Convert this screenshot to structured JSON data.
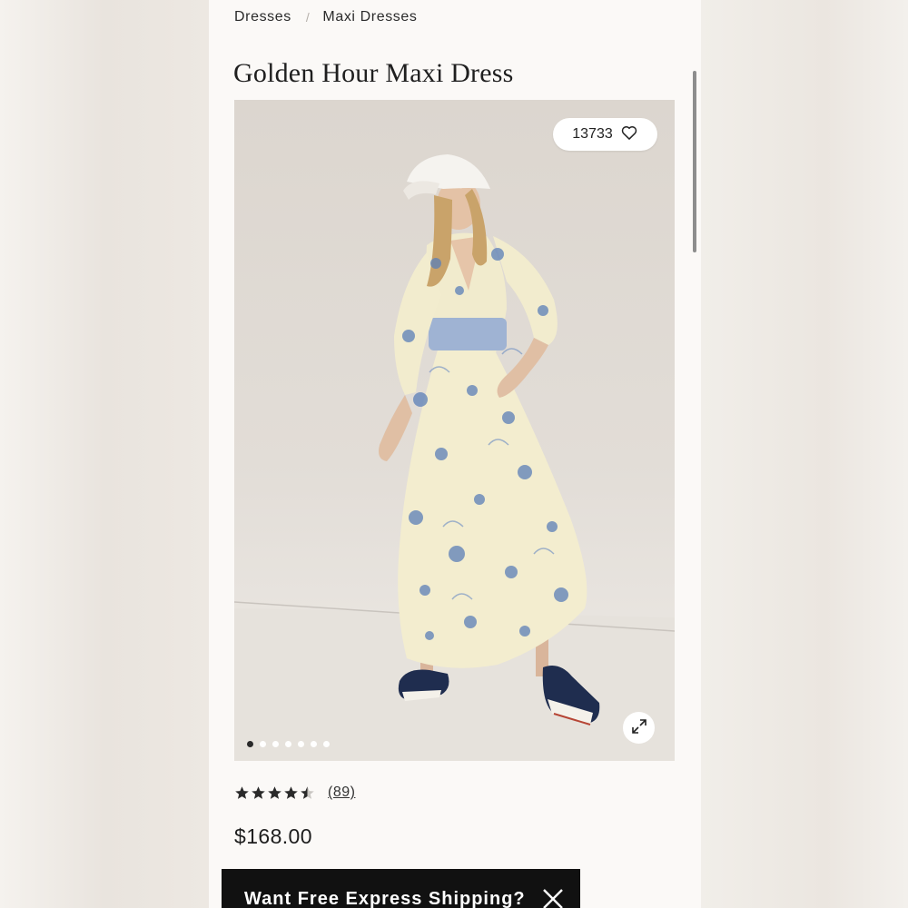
{
  "breadcrumb": {
    "items": [
      "Dresses",
      "Maxi Dresses"
    ],
    "separator": "/"
  },
  "product": {
    "title": "Golden Hour Maxi Dress",
    "favorite_count": "13733",
    "rating": 4.5,
    "reviews_label": "(89)",
    "price": "$168.00"
  },
  "gallery": {
    "image_count": 7,
    "active_index": 0
  },
  "banner": {
    "text": "Want Free Express Shipping?",
    "close_icon": "close-icon"
  },
  "icons": {
    "favorite": "heart-icon",
    "expand": "expand-icon",
    "star": "star-icon"
  },
  "colors": {
    "banner_bg": "#111111",
    "dress_blue": "#5b7fb8",
    "dress_cream": "#f3edcf",
    "shoe_navy": "#1f2d4f"
  }
}
